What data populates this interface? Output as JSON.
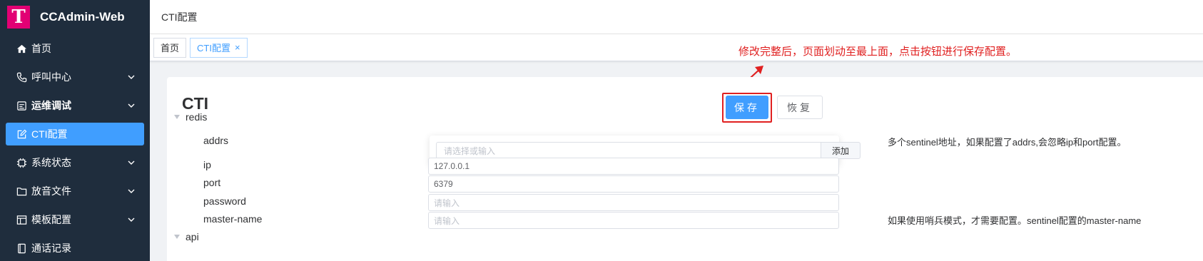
{
  "app": {
    "title": "CCAdmin-Web",
    "logo_letter": "T",
    "brand_color": "#e20074"
  },
  "sidebar": {
    "items": [
      {
        "label": "首页",
        "icon": "home-icon",
        "expandable": false
      },
      {
        "label": "呼叫中心",
        "icon": "phone-icon",
        "expandable": true
      },
      {
        "label": "运维调试",
        "icon": "monitor-icon",
        "expandable": true,
        "bold": true
      },
      {
        "label": "CTI配置",
        "icon": "edit-icon",
        "expandable": false,
        "active": true
      },
      {
        "label": "系统状态",
        "icon": "chip-icon",
        "expandable": true
      },
      {
        "label": "放音文件",
        "icon": "folder-icon",
        "expandable": true
      },
      {
        "label": "模板配置",
        "icon": "template-icon",
        "expandable": true
      },
      {
        "label": "通话记录",
        "icon": "record-icon",
        "expandable": false
      }
    ]
  },
  "header": {
    "breadcrumb": "CTI配置"
  },
  "tags": [
    {
      "label": "首页",
      "active": false
    },
    {
      "label": "CTI配置",
      "active": true,
      "close": "×"
    }
  ],
  "annotation": {
    "text": "修改完整后，页面划动至最上面，点击按钮进行保存配置。",
    "color": "#e02020"
  },
  "card": {
    "title": "CTI",
    "save_label": "保存",
    "reset_label": "恢复",
    "sections": {
      "redis": {
        "label": "redis",
        "addrs": {
          "label": "addrs",
          "placeholder": "请选择或输入",
          "add_label": "添加",
          "desc": "多个sentinel地址，如果配置了addrs,会忽略ip和port配置。"
        },
        "ip": {
          "label": "ip",
          "value": "127.0.0.1"
        },
        "port": {
          "label": "port",
          "value": "6379"
        },
        "password": {
          "label": "password",
          "placeholder": "请输入"
        },
        "master_name": {
          "label": "master-name",
          "placeholder": "请输入",
          "desc": "如果使用哨兵模式，才需要配置。sentinel配置的master-name"
        }
      },
      "api": {
        "label": "api"
      }
    }
  }
}
